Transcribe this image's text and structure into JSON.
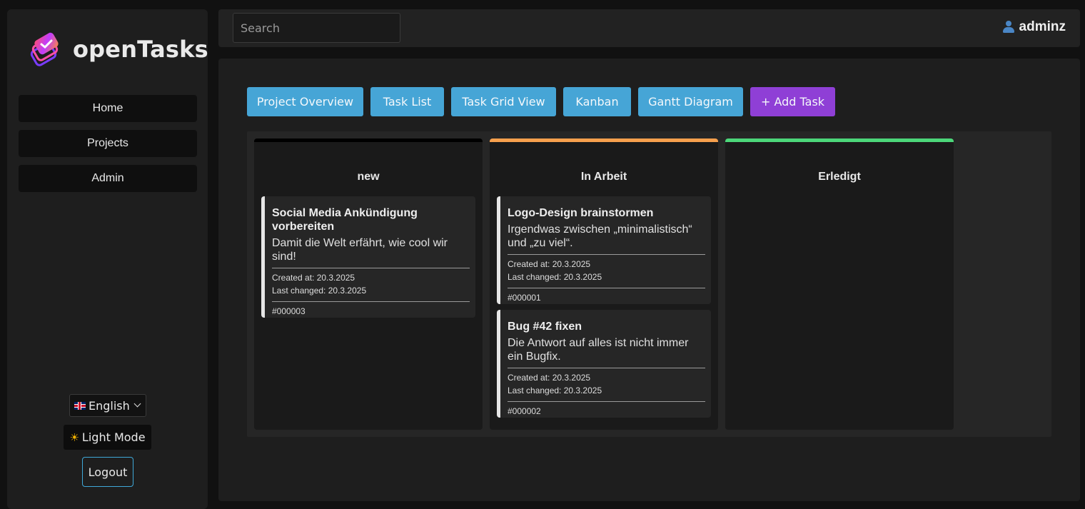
{
  "app": {
    "name": "openTasks"
  },
  "sidebar": {
    "items": [
      {
        "label": "Home"
      },
      {
        "label": "Projects"
      },
      {
        "label": "Admin"
      }
    ],
    "language": "English",
    "theme_toggle": "Light Mode",
    "logout": "Logout"
  },
  "topbar": {
    "search_placeholder": "Search",
    "username": "adminz"
  },
  "toolbar": {
    "buttons": [
      {
        "label": "Project Overview"
      },
      {
        "label": "Task List"
      },
      {
        "label": "Task Grid View"
      },
      {
        "label": "Kanban"
      },
      {
        "label": "Gantt Diagram"
      },
      {
        "label": "+ Add Task"
      }
    ]
  },
  "colors": {
    "accent_blue": "#46a5d6",
    "accent_purple": "#8f3fd6",
    "column_new": "#000000",
    "column_in_progress": "#f7a04d",
    "column_done": "#4cd77a"
  },
  "board": {
    "columns": [
      {
        "title": "new",
        "cards": [
          {
            "title": "Social Media Ankündigung vorbereiten",
            "description": "Damit die Welt erfährt, wie cool wir sind!",
            "created": "Created at: 20.3.2025",
            "changed": "Last changed: 20.3.2025",
            "id": "#000003"
          }
        ]
      },
      {
        "title": "In Arbeit",
        "cards": [
          {
            "title": "Logo-Design brainstormen",
            "description": "Irgendwas zwischen „minimalistisch“ und „zu viel“.",
            "created": "Created at: 20.3.2025",
            "changed": "Last changed: 20.3.2025",
            "id": "#000001"
          },
          {
            "title": "Bug #42 fixen",
            "description": "Die Antwort auf alles ist nicht immer ein Bugfix.",
            "created": "Created at: 20.3.2025",
            "changed": "Last changed: 20.3.2025",
            "id": "#000002"
          }
        ]
      },
      {
        "title": "Erledigt",
        "cards": []
      }
    ]
  }
}
